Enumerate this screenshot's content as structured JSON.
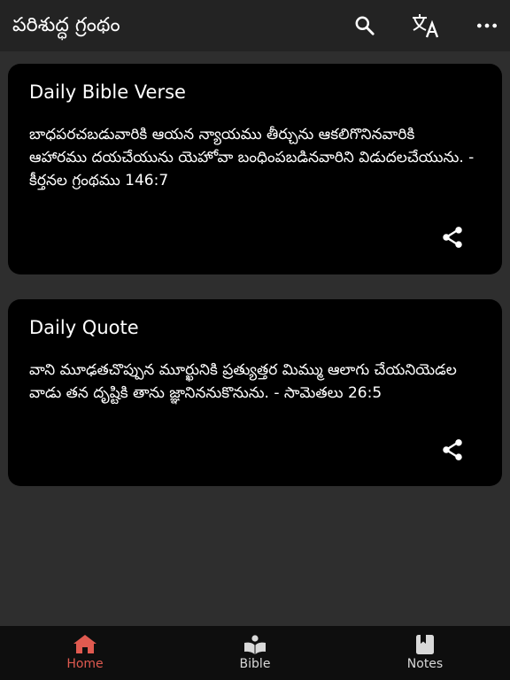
{
  "app": {
    "title": "పరిశుద్ధ గ్రంథం",
    "actions": [
      {
        "name": "search",
        "icon": "search-icon"
      },
      {
        "name": "translate",
        "icon": "translate-icon"
      },
      {
        "name": "more",
        "icon": "more-vertical-icon"
      }
    ]
  },
  "cards": [
    {
      "title": "Daily Bible Verse",
      "text": "బాధపరచబడువారికి ఆయన న్యాయము తీర్చును ఆకలిగొనినవారికి ఆహారము దయచేయును యెహోవా బంధింపబడినవారిని విడుదలచేయును. - కీర్తనల గ్రంథము 146:7",
      "share_icon": "share-icon"
    },
    {
      "title": "Daily Quote",
      "text": "వాని మూఢతచొప్పున మూర్ఖునికి ప్రత్యుత్తర మిమ్ము ఆలాగు చేయనియెడల వాడు తన దృష్టికి తాను జ్ఞానిననుకొనును. - సామెతలు 26:5",
      "share_icon": "share-icon"
    }
  ],
  "nav": {
    "active": "Home",
    "items": [
      {
        "label": "Home",
        "icon": "home-icon"
      },
      {
        "label": "Bible",
        "icon": "bible-icon"
      },
      {
        "label": "Notes",
        "icon": "notes-icon"
      }
    ]
  },
  "colors": {
    "background": "#2e2e2e",
    "appbar": "#232323",
    "card": "#000000",
    "nav_background": "#0e0e0e",
    "accent": "#e05a50"
  }
}
